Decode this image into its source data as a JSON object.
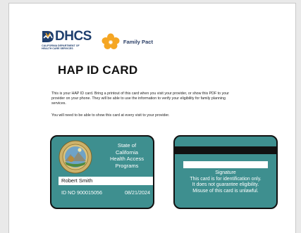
{
  "header": {
    "agency_logo_text": "DHCS",
    "agency_logo_subtext": [
      "CALIFORNIA DEPARTMENT OF",
      "HEALTH CARE SERVICES"
    ],
    "program_name": "Family Pact"
  },
  "title": "HAP ID CARD",
  "intro_paragraph": "This is your HAP ID card. Bring a printout of this card when you visit your provider, or show this PDF to your provider on your phone. They will be able to use the information to verify your eligibility for family planning services.",
  "visit_paragraph": "You will need to be able to show this card at every visit to your provider.",
  "card_front": {
    "state_lines": [
      "State of",
      "California",
      "Health Access",
      "Programs"
    ],
    "member_name": "Robert Smith",
    "id_number": "ID NO 900015056",
    "date": "08/21/2024"
  },
  "card_back": {
    "signature_label": "Signature",
    "notice_lines": [
      "This card is for identification only.",
      "It does not guarantee eligibility.",
      "Misuse of this card is unlawful."
    ]
  },
  "colors": {
    "card_teal": "#3e8f8f",
    "logo_navy": "#1f3f6e",
    "logo_orange": "#f5a623"
  },
  "icons": {
    "agency_logo": "dhcs-logo-icon",
    "program_logo": "flower-logo-icon",
    "seal": "california-state-seal-icon"
  }
}
